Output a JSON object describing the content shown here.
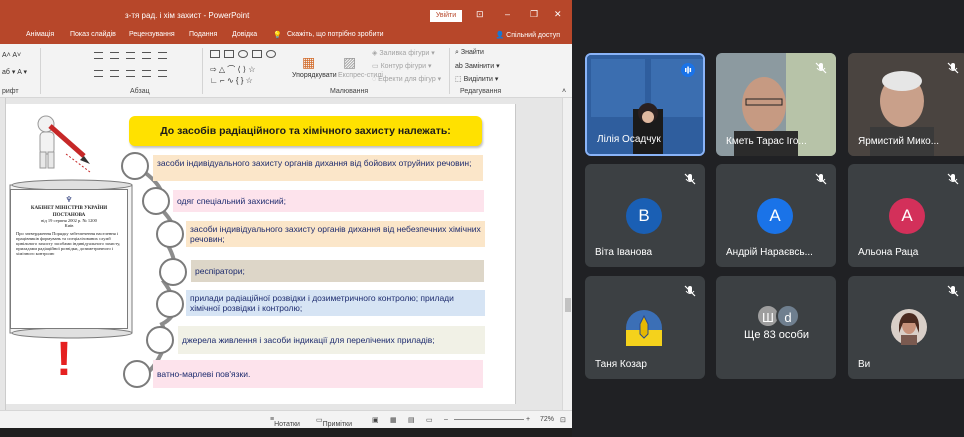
{
  "powerpoint": {
    "title": "з-тя рад. і хім захист - PowerPoint",
    "signin": "Увійти",
    "tabs": [
      "Анімація",
      "Показ слайдів",
      "Рецензування",
      "Подання",
      "Довідка"
    ],
    "tell_me": "Скажіть, що потрібно зробити",
    "share": "Спільний доступ",
    "ribbon": {
      "group_font_label": "рифт",
      "group_para_label": "Абзац",
      "group_draw_label": "Малювання",
      "group_edit_label": "Редагування",
      "arrange": "Упорядкувати",
      "quick_styles": "Експрес-стилі",
      "shape_fill": "Заливка фігури",
      "shape_outline": "Контур фігури",
      "shape_effects": "Ефекти для фігур",
      "find": "Знайти",
      "replace": "Замінити",
      "select": "Виділити"
    },
    "slide": {
      "title": "До засобів радіаційного та хімічного захисту належать:",
      "items": [
        {
          "text": "засоби індивідуального захисту органів дихання від бойових отруйних речовин;",
          "color": "#fbe6c9"
        },
        {
          "text": "одяг спеціальний захисний;",
          "color": "#fde3ec"
        },
        {
          "text": "засоби індивідуального захисту органів дихання від небезпечних хімічних речовин;",
          "color": "#fbe6c9"
        },
        {
          "text": "респіратори;",
          "color": "#ddd6c8"
        },
        {
          "text": "прилади радіаційної розвідки і дозиметричного контролю; прилади хімічної розвідки і контролю;",
          "color": "#d6e4f4"
        },
        {
          "text": "джерела живлення і засоби індикації для перелічених приладів;",
          "color": "#f1f1e6"
        },
        {
          "text": "ватно-марлеві пов'язки.",
          "color": "#fde3ec"
        }
      ],
      "doc": {
        "line1": "КАБІНЕТ МІНІСТРІВ УКРАЇНИ",
        "line2": "ПОСТАНОВА",
        "line3": "від 19 серпня 2002 р. № 1200",
        "line4": "Київ",
        "body": "Про затвердження Порядку забезпечення населення і працівників формувань та спеціалізованих служб цивільного захисту засобами індивідуального захисту, приладами радіаційної розвідки, дозиметричного і хімічного контролю"
      },
      "exclaim": "!"
    },
    "status": {
      "notes": "Нотатки",
      "comments": "Примітки",
      "zoom": "72%"
    }
  },
  "meeting": {
    "participants": [
      {
        "name": "Лілія Осадчук",
        "type": "video",
        "speaking": true
      },
      {
        "name": "Кметь Тарас Іго...",
        "type": "video",
        "muted": true
      },
      {
        "name": "Ярмистий Мико...",
        "type": "video",
        "muted": true
      },
      {
        "name": "Віта Іванова",
        "initial": "В",
        "color": "#1a5fb4",
        "muted": true
      },
      {
        "name": "Андрій Нараєвсь...",
        "initial": "А",
        "color": "#1a73e8",
        "muted": true
      },
      {
        "name": "Альона Раца",
        "initial": "А",
        "color": "#d3305a",
        "muted": true
      },
      {
        "name": "Таня Козар",
        "type": "emblem",
        "muted": true
      },
      {
        "name": "Ще 83 особи",
        "initials": [
          "Ш",
          "d"
        ]
      },
      {
        "name": "Ви",
        "type": "photo",
        "muted": true
      }
    ]
  }
}
